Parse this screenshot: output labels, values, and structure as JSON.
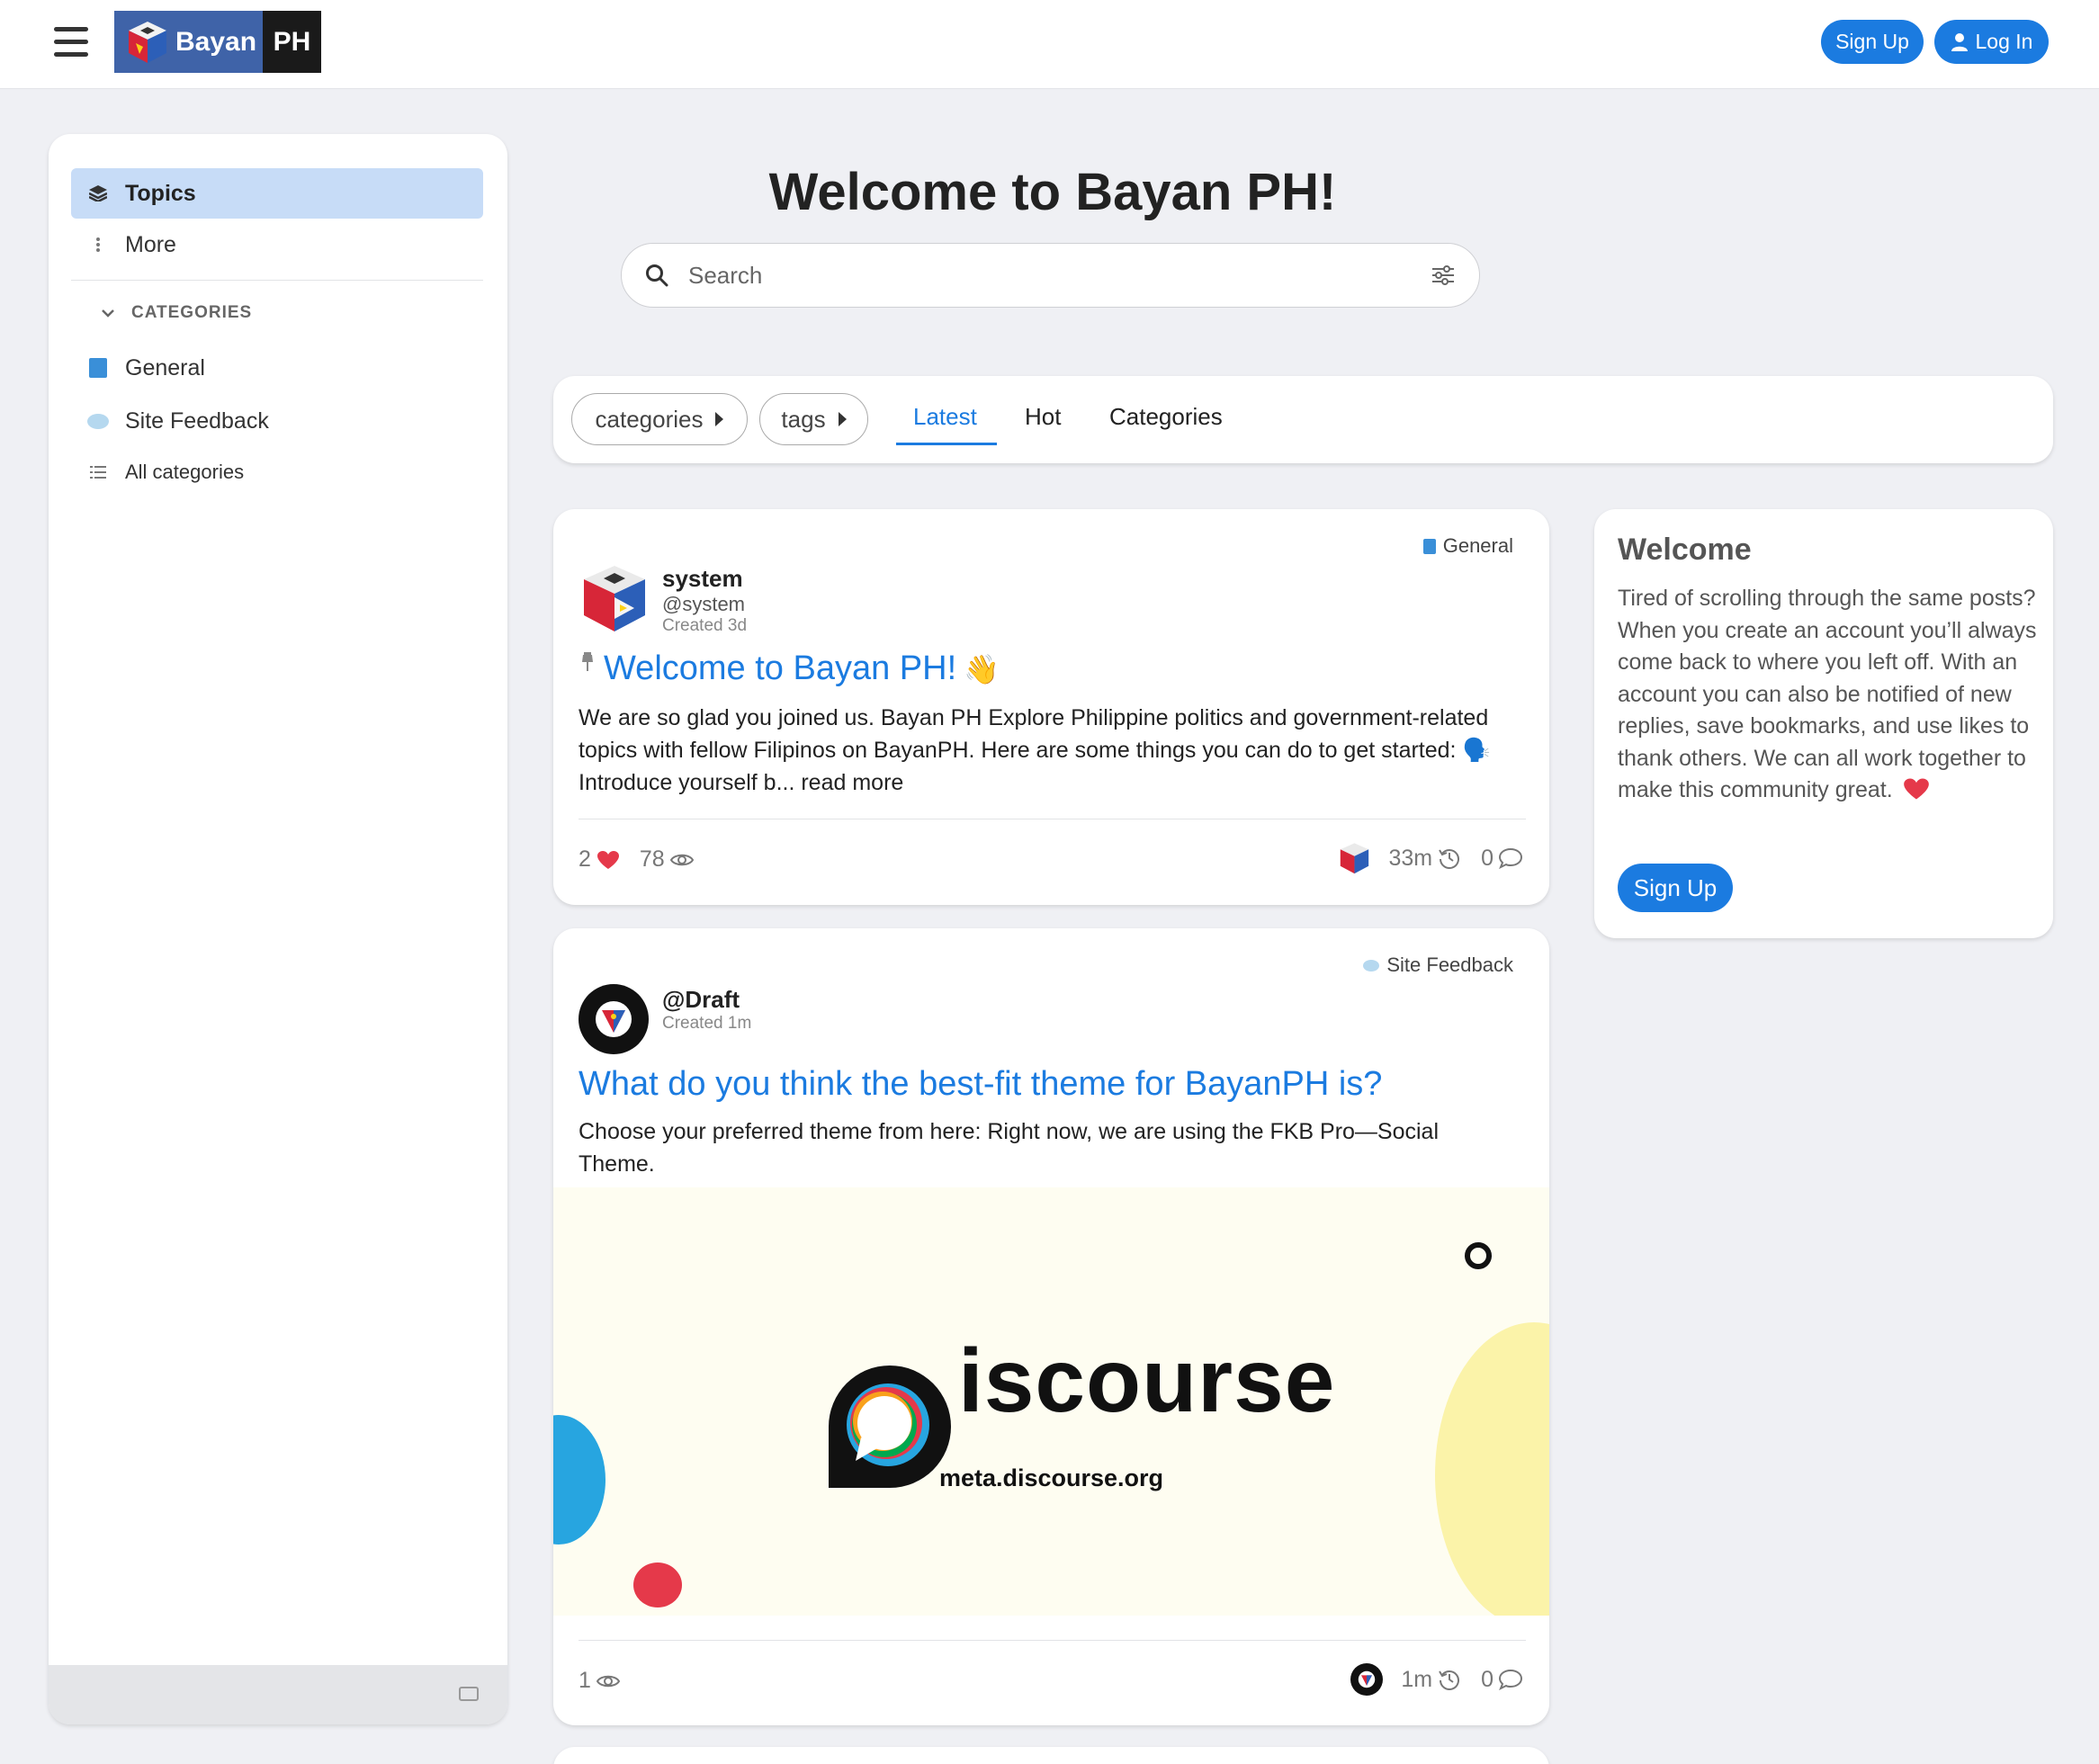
{
  "header": {
    "logo_word1": "Bayan",
    "logo_word2": "PH",
    "signup_label": "Sign Up",
    "login_label": "Log In"
  },
  "sidebar": {
    "topics_label": "Topics",
    "more_label": "More",
    "categories_header": "CATEGORIES",
    "categories": [
      {
        "label": "General",
        "color": "#3a8fd8"
      },
      {
        "label": "Site Feedback",
        "color": "#b5d8ef"
      }
    ],
    "all_categories_label": "All categories"
  },
  "hero": {
    "title": "Welcome to Bayan PH!",
    "search_placeholder": "Search"
  },
  "filters": {
    "categories_pill": "categories",
    "tags_pill": "tags",
    "tabs": [
      "Latest",
      "Hot",
      "Categories"
    ],
    "active_tab": "Latest"
  },
  "posts": [
    {
      "category": "General",
      "author_name": "system",
      "author_handle": "@system",
      "created": "Created 3d",
      "title": "Welcome to Bayan PH!",
      "excerpt": "We are so glad you joined us. Bayan PH Explore Philippine politics and government-related topics with fellow Filipinos on BayanPH. Here are some things you can do to get started: 🗣️ Introduce yourself b... read more",
      "likes": "2",
      "views": "78",
      "last_activity": "33m",
      "replies": "0"
    },
    {
      "category": "Site Feedback",
      "author_name": "@Draft",
      "created": "Created 1m",
      "title": "What do you think the best-fit theme for BayanPH is?",
      "excerpt": "Choose your preferred theme from here: Right now, we are using the FKB Pro—Social Theme.",
      "image_brand": "iscourse",
      "image_url_text": "meta.discourse.org",
      "views": "1",
      "last_activity": "1m",
      "replies": "0"
    }
  ],
  "welcome_box": {
    "title": "Welcome",
    "text": "Tired of scrolling through the same posts? When you create an account you’ll always come back to where you left off. With an account you can also be notified of new replies, save bookmarks, and use likes to thank others. We can all work together to make this community great.",
    "button_label": "Sign Up"
  },
  "colors": {
    "accent": "#1b7be0",
    "active_nav_bg": "#c7dcf7",
    "heart": "#e5394a"
  }
}
